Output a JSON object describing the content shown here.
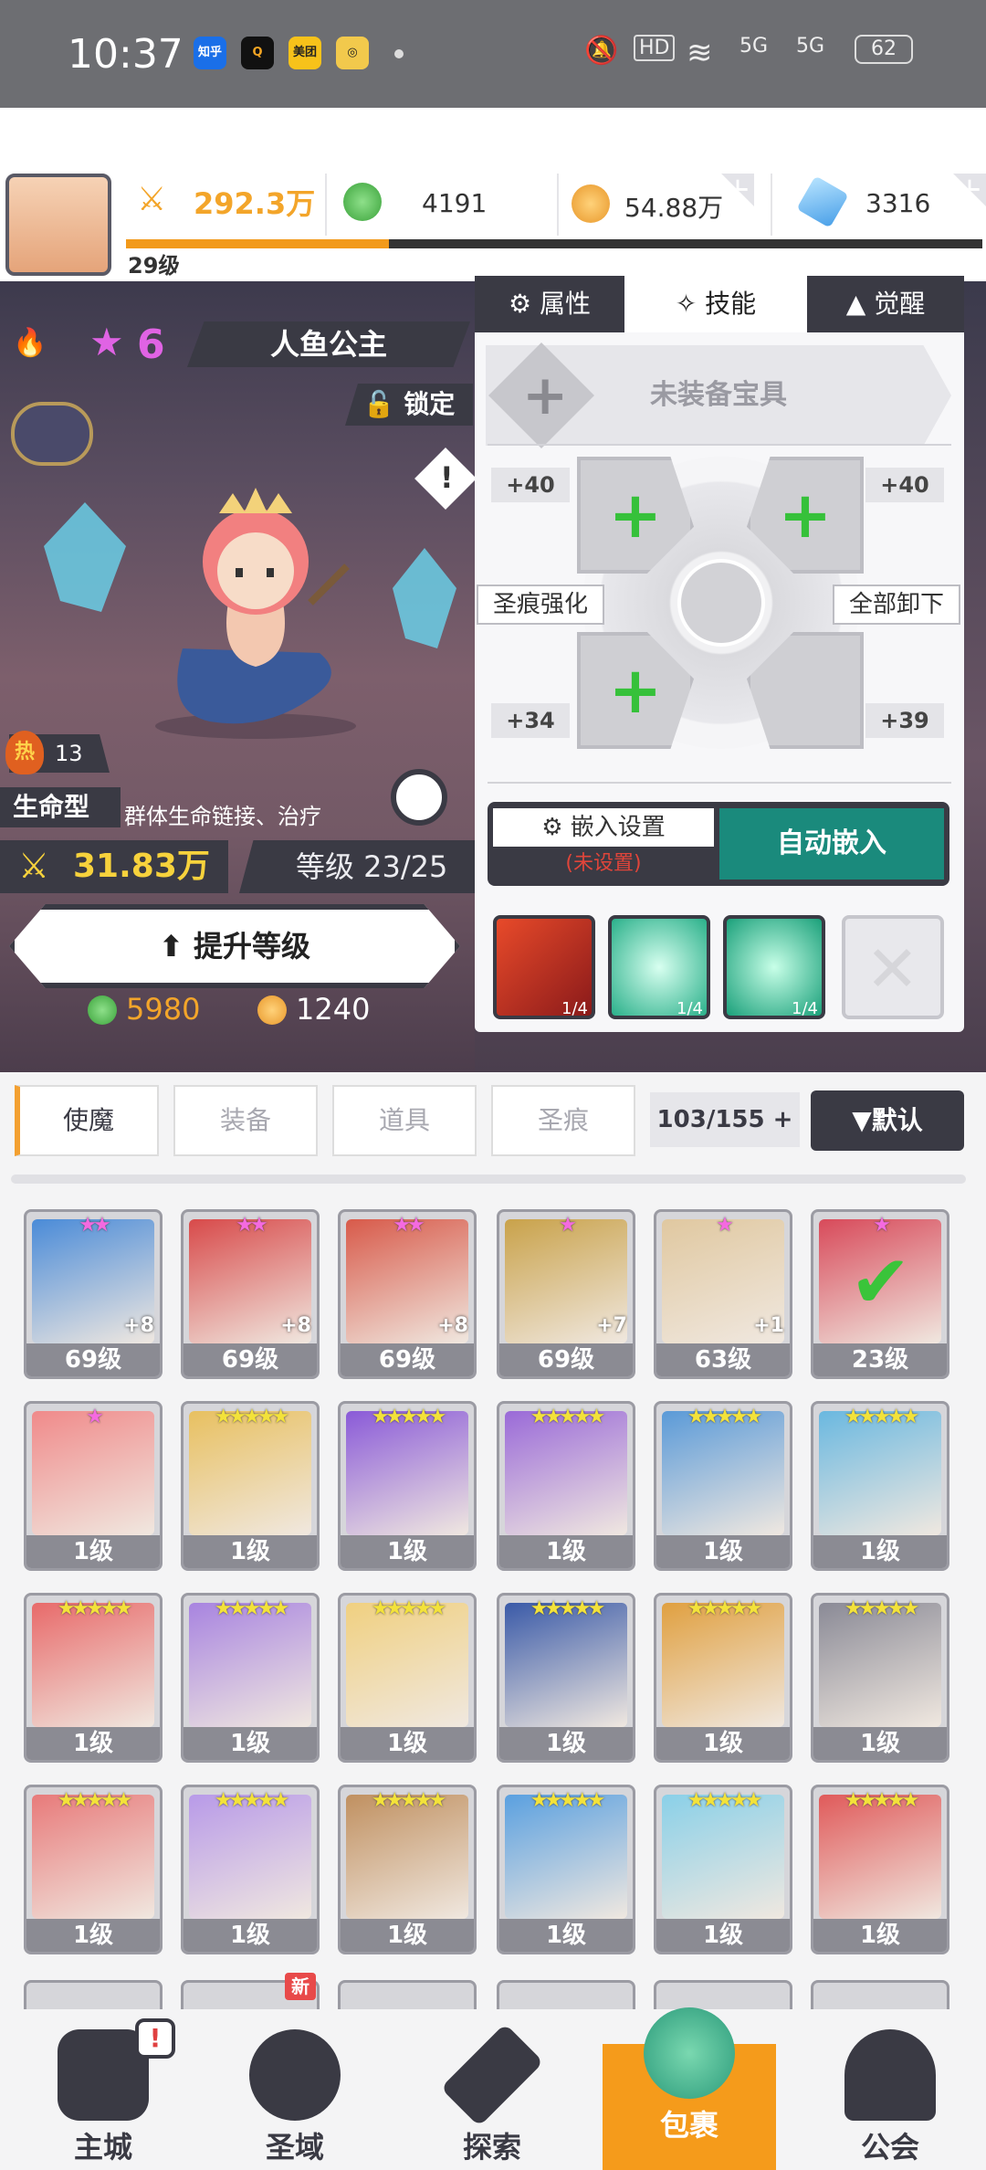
{
  "status_bar": {
    "time": "10:37",
    "apps": [
      "知乎",
      "Q",
      "美团",
      "◎"
    ],
    "signal": "5G",
    "signal2": "5G",
    "battery": "62",
    "hd": "HD"
  },
  "top": {
    "power": "292.3万",
    "green_gem": "4191",
    "gold": "54.88万",
    "diamond": "3316",
    "player_level": "29级",
    "xp_progress": 0.31
  },
  "hero": {
    "name": "人鱼公主",
    "stars": "6",
    "lock": "锁定",
    "rank": "13 名",
    "hot": "热",
    "type": "生命型",
    "skill_desc": "群体生命链接、治疗",
    "power": "31.83万",
    "level": "等级 23/25",
    "upgrade": "提升等级",
    "cost_green": "5980",
    "cost_gold": "1240"
  },
  "panel": {
    "tabs": [
      "属性",
      "技能",
      "觉醒"
    ],
    "active_tab": "技能",
    "relic": "未装备宝具",
    "vals": {
      "tl": "+40",
      "tr": "+40",
      "bl": "+34",
      "br": "+39"
    },
    "strengthen": "圣痕强化",
    "unload": "全部卸下",
    "embed_settings": "嵌入设置",
    "embed_unset": "(未设置)",
    "auto_embed": "自动嵌入",
    "skills": [
      "1/4",
      "1/4",
      "1/4"
    ]
  },
  "inventory": {
    "tabs": [
      "使魔",
      "装备",
      "道具",
      "圣痕"
    ],
    "active": "使魔",
    "count": "103/155",
    "sort": "▼默认",
    "rows": [
      [
        {
          "l": "69级",
          "s": "★★",
          "p": true,
          "v": "+8",
          "c": "#4a8bd8"
        },
        {
          "l": "69级",
          "s": "★★",
          "p": true,
          "v": "+8",
          "c": "#d84a4a"
        },
        {
          "l": "69级",
          "s": "★★",
          "p": true,
          "v": "+8",
          "c": "#d85a4a"
        },
        {
          "l": "69级",
          "s": "★",
          "p": true,
          "v": "+7",
          "c": "#c9a24a"
        },
        {
          "l": "63级",
          "s": "★",
          "p": true,
          "v": "+1",
          "c": "#e0c8a0"
        },
        {
          "l": "23级",
          "s": "★",
          "p": true,
          "v": "",
          "c": "#d84a5a"
        }
      ],
      [
        {
          "l": "1级",
          "s": "★",
          "p": true,
          "v": "",
          "c": "#f08a8a"
        },
        {
          "l": "1级",
          "s": "★★★★★",
          "p": false,
          "v": "",
          "c": "#e8c060"
        },
        {
          "l": "1级",
          "s": "★★★★★",
          "p": false,
          "v": "",
          "c": "#8a5ad8"
        },
        {
          "l": "1级",
          "s": "★★★★★",
          "p": false,
          "v": "",
          "c": "#9a6ad8"
        },
        {
          "l": "1级",
          "s": "★★★★★",
          "p": false,
          "v": "",
          "c": "#5a9ad8"
        },
        {
          "l": "1级",
          "s": "★★★★★",
          "p": false,
          "v": "",
          "c": "#6ab8e0"
        }
      ],
      [
        {
          "l": "1级",
          "s": "★★★★★",
          "p": false,
          "v": "",
          "c": "#e86a6a"
        },
        {
          "l": "1级",
          "s": "★★★★★",
          "p": false,
          "v": "",
          "c": "#a884e0"
        },
        {
          "l": "1级",
          "s": "★★★★★",
          "p": false,
          "v": "",
          "c": "#f0d080"
        },
        {
          "l": "1级",
          "s": "★★★★★",
          "p": false,
          "v": "",
          "c": "#3a5aa8"
        },
        {
          "l": "1级",
          "s": "★★★★★",
          "p": false,
          "v": "",
          "c": "#e0a040"
        },
        {
          "l": "1级",
          "s": "★★★★★",
          "p": false,
          "v": "",
          "c": "#8a8a96"
        }
      ],
      [
        {
          "l": "1级",
          "s": "★★★★★",
          "p": false,
          "v": "",
          "c": "#e87a7a"
        },
        {
          "l": "1级",
          "s": "★★★★★",
          "p": false,
          "v": "",
          "c": "#b89ae8"
        },
        {
          "l": "1级",
          "s": "★★★★★",
          "p": false,
          "v": "",
          "c": "#c09060"
        },
        {
          "l": "1级",
          "s": "★★★★★",
          "p": false,
          "v": "",
          "c": "#5aa0e0"
        },
        {
          "l": "1级",
          "s": "★★★★★",
          "p": false,
          "v": "",
          "c": "#8ad0e8"
        },
        {
          "l": "1级",
          "s": "★★★★★",
          "p": false,
          "v": "",
          "c": "#e05a5a"
        }
      ]
    ],
    "new_badge": "新"
  },
  "nav": [
    {
      "label": "主城",
      "badge": "!"
    },
    {
      "label": "圣域"
    },
    {
      "label": "探索"
    },
    {
      "label": "包裹",
      "active": true
    },
    {
      "label": "公会"
    }
  ],
  "colors": {
    "accent": "#f59b1b",
    "teal": "#1a8a7c",
    "dark": "#3a3a44"
  }
}
